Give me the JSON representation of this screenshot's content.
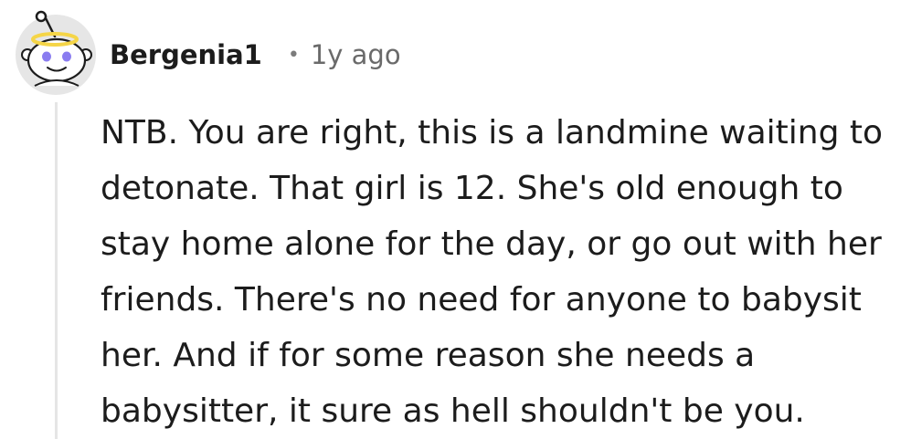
{
  "comment": {
    "author": "Bergenia1",
    "separator": "•",
    "timestamp": "1y ago",
    "body": "NTB. You are right, this is a landmine waiting to\ndetonate. That girl is 12. She's old enough to\nstay home alone for the day, or go out with her\nfriends. There's no need for anyone to babysit\nher. And if for some reason she needs a\nbabysitter, it sure as hell shouldn't be you."
  },
  "avatar": {
    "icon": "reddit-snoo-avatar-icon",
    "background_color": "#e6e6e6",
    "halo_color": "#f5d547",
    "eye_color": "#8a7cf0"
  }
}
